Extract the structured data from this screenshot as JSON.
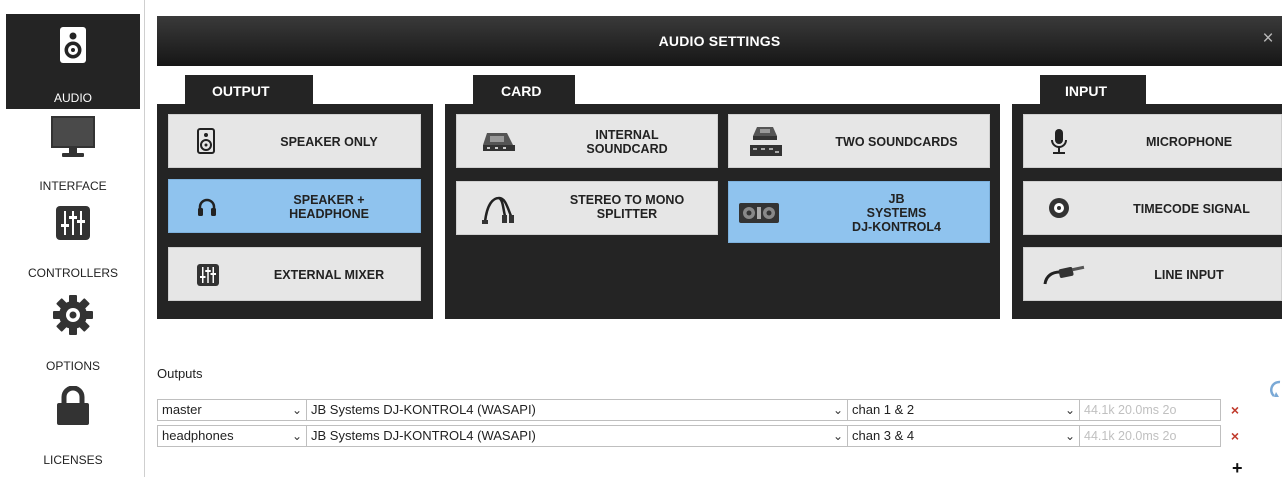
{
  "window": {
    "title": "AUDIO SETTINGS",
    "close_glyph": "×"
  },
  "sidebar": {
    "items": [
      {
        "label": "AUDIO",
        "icon": "speaker-icon",
        "active": true
      },
      {
        "label": "INTERFACE",
        "icon": "monitor-icon",
        "active": false
      },
      {
        "label": "CONTROLLERS",
        "icon": "mixer-sliders-icon",
        "active": false
      },
      {
        "label": "OPTIONS",
        "icon": "gear-icon",
        "active": false
      },
      {
        "label": "LICENSES",
        "icon": "lock-icon",
        "active": false
      }
    ]
  },
  "groups": {
    "output": {
      "label": "OUTPUT",
      "buttons": [
        {
          "label": "SPEAKER ONLY",
          "icon": "speaker-icon",
          "selected": false
        },
        {
          "label": "SPEAKER +\nHEADPHONE",
          "icon": "headphones-icon",
          "selected": true
        },
        {
          "label": "EXTERNAL MIXER",
          "icon": "mixer-sliders-icon",
          "selected": false
        }
      ]
    },
    "card": {
      "label": "CARD",
      "buttons": [
        {
          "label": "INTERNAL\nSOUNDCARD",
          "icon": "soundcard-icon",
          "selected": false
        },
        {
          "label": "TWO SOUNDCARDS",
          "icon": "two-soundcards-icon",
          "selected": false
        },
        {
          "label": "STEREO TO MONO\nSPLITTER",
          "icon": "splitter-cable-icon",
          "selected": false
        },
        {
          "label": "JB\nSYSTEMS\nDJ-KONTROL4",
          "icon": "dj-controller-icon",
          "selected": true
        }
      ]
    },
    "input": {
      "label": "INPUT",
      "buttons": [
        {
          "label": "MICROPHONE",
          "icon": "microphone-icon",
          "selected": false
        },
        {
          "label": "TIMECODE SIGNAL",
          "icon": "vinyl-record-icon",
          "selected": false
        },
        {
          "label": "LINE INPUT",
          "icon": "jack-cable-icon",
          "selected": false
        }
      ]
    }
  },
  "outputs": {
    "label": "Outputs",
    "rows": [
      {
        "channel": "master",
        "device": "JB Systems DJ-KONTROL4 (WASAPI)",
        "chan": "chan 1 & 2",
        "info": "44.1k 20.0ms 2o"
      },
      {
        "channel": "headphones",
        "device": "JB Systems DJ-KONTROL4 (WASAPI)",
        "chan": "chan 3 & 4",
        "info": "44.1k 20.0ms 2o"
      }
    ],
    "chevron_glyph": "⌄",
    "remove_glyph": "×",
    "add_glyph": "+"
  },
  "colors": {
    "dark": "#242424",
    "button": "#e6e6e6",
    "selected": "#8fc3ee",
    "remove": "#c0392b",
    "info_text": "#c0c0c0"
  }
}
